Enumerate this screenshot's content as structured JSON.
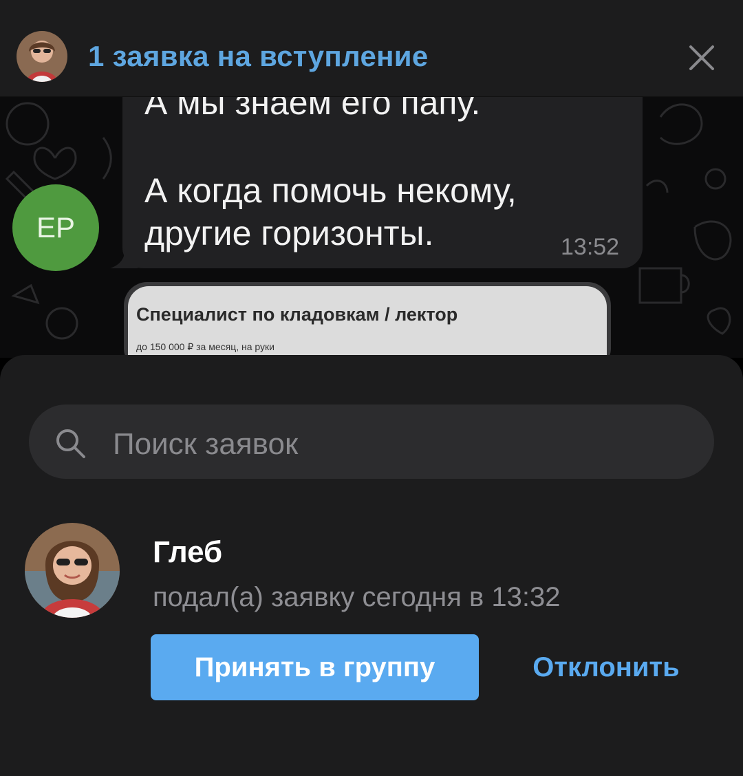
{
  "banner": {
    "title": "1 заявка на вступление",
    "avatar_icon": "user-photo-avatar",
    "close_icon": "close-icon"
  },
  "chat": {
    "sender_initials": "ЕР",
    "message_lines": [
      "А мы знаем его папу.",
      "",
      "А когда помочь некому,",
      "другие горизонты."
    ],
    "time": "13:52",
    "preview": {
      "title": "Специалист по кладовкам / лектор",
      "subtitle": "до 150 000 ₽ за месяц, на руки"
    }
  },
  "sheet": {
    "search_placeholder": "Поиск заявок",
    "request": {
      "name": "Глеб",
      "meta": "подал(а) заявку сегодня в 13:32",
      "accept_label": "Принять в группу",
      "decline_label": "Отклонить"
    }
  },
  "colors": {
    "accent": "#5aaaf0",
    "banner_link": "#5ea6e0",
    "avatar_green": "#4f9a3f",
    "sheet_bg": "#1c1c1d",
    "bubble_bg": "#212123"
  }
}
